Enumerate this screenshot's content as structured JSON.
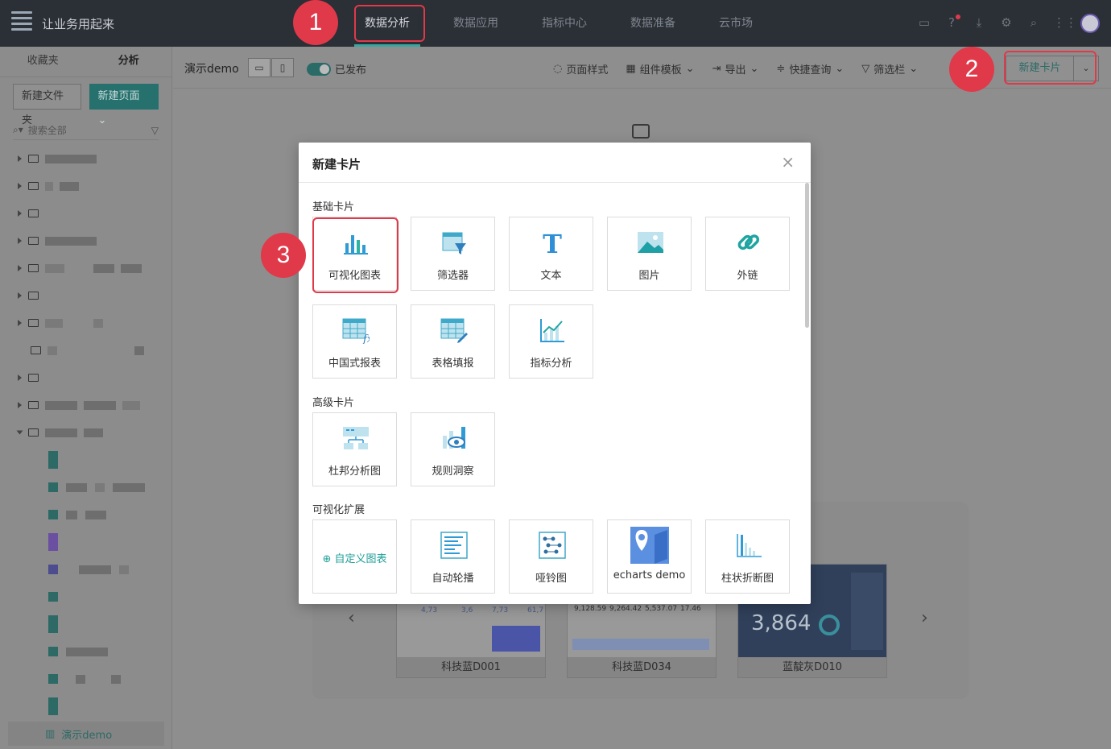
{
  "app": {
    "title": "让业务用起来"
  },
  "nav": {
    "items": [
      "数据分析",
      "数据应用",
      "指标中心",
      "数据准备",
      "云市场"
    ]
  },
  "sidebar": {
    "tabs": [
      "收藏夹",
      "分析"
    ],
    "new_folder": "新建文件夹",
    "new_page": "新建页面",
    "search_placeholder": "搜索全部",
    "footer": "演示demo"
  },
  "toolbar": {
    "page_title": "演示demo",
    "published": "已发布",
    "items": [
      "页面样式",
      "组件模板",
      "导出",
      "快捷查询",
      "筛选栏"
    ],
    "new_card": "新建卡片"
  },
  "dialog": {
    "title": "新建卡片",
    "sections": {
      "basic": "基础卡片",
      "advanced": "高级卡片",
      "extend": "可视化扩展"
    },
    "basic_cards": [
      "可视化图表",
      "筛选器",
      "文本",
      "图片",
      "外链",
      "中国式报表",
      "表格填报",
      "指标分析"
    ],
    "advanced_cards": [
      "杜邦分析图",
      "规则洞察"
    ],
    "extend_cards": [
      "自定义图表",
      "自动轮播",
      "哑铃图",
      "echarts demo",
      "柱状折断图"
    ]
  },
  "carousel": {
    "templates": [
      "科技蓝D001",
      "科技蓝D034",
      "蓝靛灰D010"
    ],
    "big_number": "3,864",
    "mini_values": [
      "4,73",
      "3,6",
      "7,73",
      "61,7",
      "9,128.59",
      "9,264.42",
      "5,537.07",
      "17.46"
    ]
  },
  "annotations": [
    "1",
    "2",
    "3"
  ],
  "colors": {
    "accent": "#2d9b96",
    "red": "#e0394a",
    "topbar": "#2b2f36"
  }
}
